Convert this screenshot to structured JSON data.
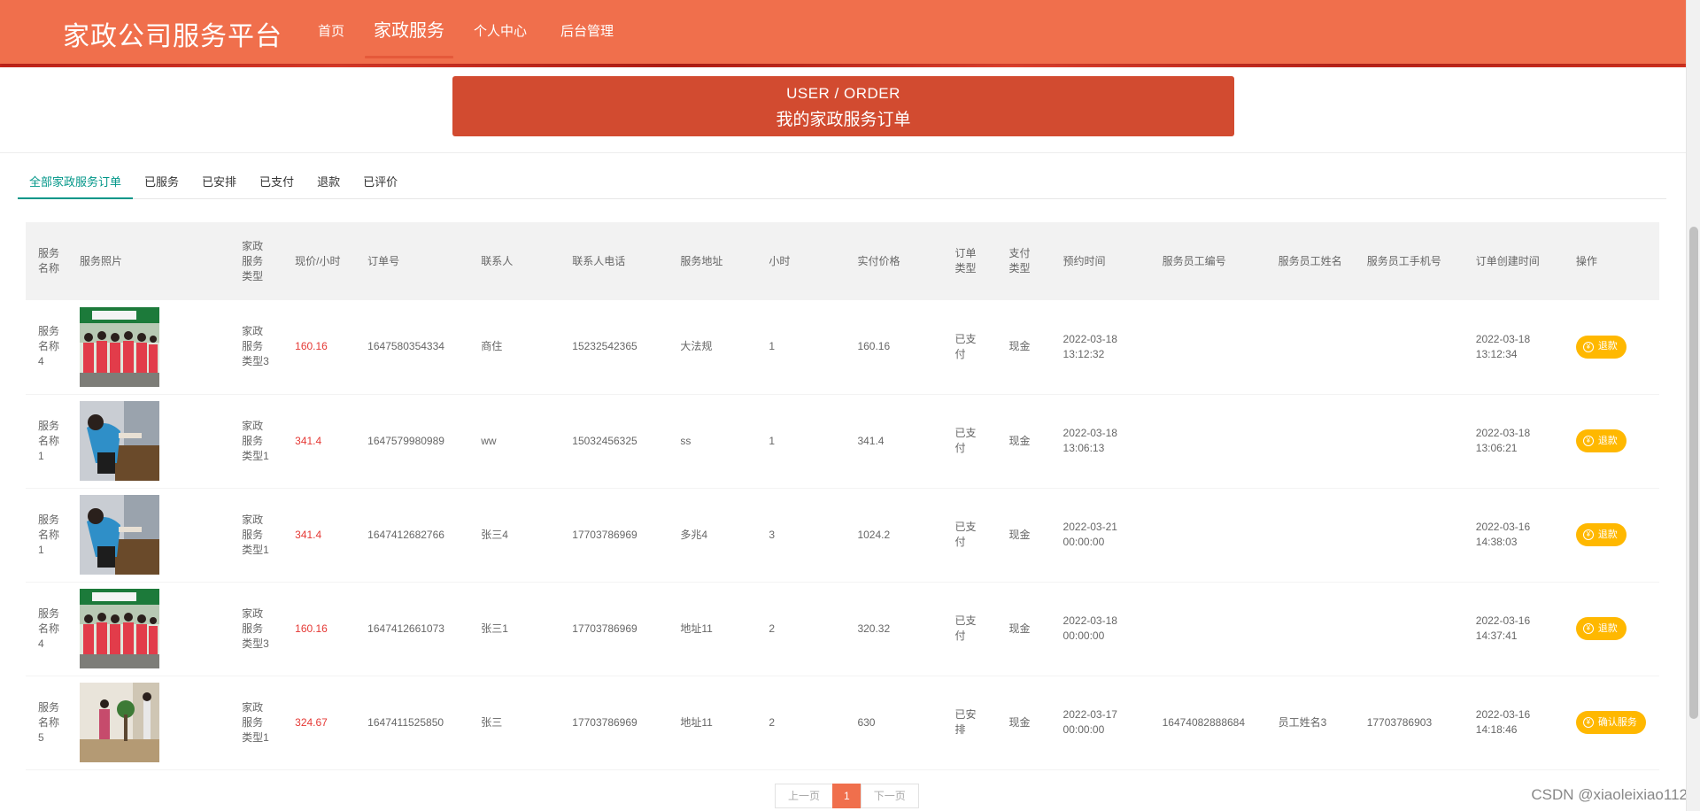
{
  "header": {
    "brand": "家政公司服务平台",
    "nav": [
      "首页",
      "家政服务",
      "个人中心",
      "后台管理"
    ]
  },
  "page_title": {
    "en": "USER / ORDER",
    "cn": "我的家政服务订单"
  },
  "tabs": [
    "全部家政服务订单",
    "已服务",
    "已安排",
    "已支付",
    "退款",
    "已评价"
  ],
  "table": {
    "headers": [
      "服务名称",
      "服务照片",
      "家政服务类型",
      "现价/小时",
      "订单号",
      "联系人",
      "联系人电话",
      "服务地址",
      "小时",
      "实付价格",
      "订单类型",
      "支付类型",
      "预约时间",
      "服务员工编号",
      "服务员工姓名",
      "服务员工手机号",
      "订单创建时间",
      "操作"
    ],
    "rows": [
      {
        "name": "服务名称4",
        "type": "家政服务类型3",
        "price": "160.16",
        "order_no": "1647580354334",
        "contact": "商住",
        "phone": "15232542365",
        "address": "大法规",
        "hours": "1",
        "paid": "160.16",
        "order_type": "已支付",
        "pay_type": "现金",
        "appoint_time": "2022-03-18 13:12:32",
        "staff_no": "",
        "staff_name": "",
        "staff_phone": "",
        "created": "2022-03-18 13:12:34",
        "action": "退款"
      },
      {
        "name": "服务名称1",
        "type": "家政服务类型1",
        "price": "341.4",
        "order_no": "1647579980989",
        "contact": "ww",
        "phone": "15032456325",
        "address": "ss",
        "hours": "1",
        "paid": "341.4",
        "order_type": "已支付",
        "pay_type": "现金",
        "appoint_time": "2022-03-18 13:06:13",
        "staff_no": "",
        "staff_name": "",
        "staff_phone": "",
        "created": "2022-03-18 13:06:21",
        "action": "退款"
      },
      {
        "name": "服务名称1",
        "type": "家政服务类型1",
        "price": "341.4",
        "order_no": "1647412682766",
        "contact": "张三4",
        "phone": "17703786969",
        "address": "多兆4",
        "hours": "3",
        "paid": "1024.2",
        "order_type": "已支付",
        "pay_type": "现金",
        "appoint_time": "2022-03-21 00:00:00",
        "staff_no": "",
        "staff_name": "",
        "staff_phone": "",
        "created": "2022-03-16 14:38:03",
        "action": "退款"
      },
      {
        "name": "服务名称4",
        "type": "家政服务类型3",
        "price": "160.16",
        "order_no": "1647412661073",
        "contact": "张三1",
        "phone": "17703786969",
        "address": "地址11",
        "hours": "2",
        "paid": "320.32",
        "order_type": "已支付",
        "pay_type": "现金",
        "appoint_time": "2022-03-18 00:00:00",
        "staff_no": "",
        "staff_name": "",
        "staff_phone": "",
        "created": "2022-03-16 14:37:41",
        "action": "退款"
      },
      {
        "name": "服务名称5",
        "type": "家政服务类型1",
        "price": "324.67",
        "order_no": "1647411525850",
        "contact": "张三",
        "phone": "17703786969",
        "address": "地址11",
        "hours": "2",
        "paid": "630",
        "order_type": "已安排",
        "pay_type": "现金",
        "appoint_time": "2022-03-17 00:00:00",
        "staff_no": "16474082888684",
        "staff_name": "员工姓名3",
        "staff_phone": "17703786903",
        "created": "2022-03-16 14:18:46",
        "action": "确认服务"
      }
    ]
  },
  "pager": {
    "prev": "上一页",
    "current": "1",
    "next": "下一页"
  },
  "watermark": "CSDN @xiaoleixiao112",
  "colors": {
    "header": "#f06f4c",
    "title_block": "#d24b30",
    "tab_active": "#009688",
    "price": "#e53935",
    "action_button": "#ffb800"
  }
}
